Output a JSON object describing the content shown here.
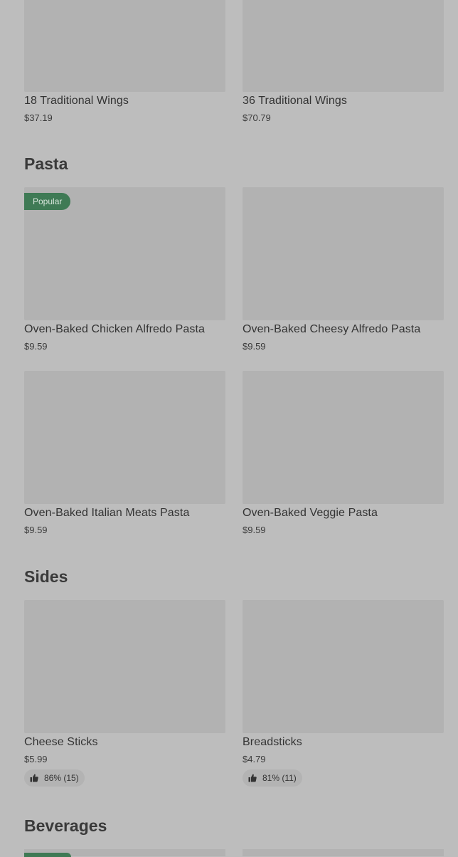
{
  "sections": {
    "wings": {
      "items": [
        {
          "name": "18 Traditional Wings",
          "price": "$37.19"
        },
        {
          "name": "36 Traditional Wings",
          "price": "$70.79"
        }
      ]
    },
    "pasta": {
      "title": "Pasta",
      "badge": "Popular",
      "items": [
        {
          "name": "Oven-Baked Chicken Alfredo Pasta",
          "price": "$9.59"
        },
        {
          "name": "Oven-Baked Cheesy Alfredo Pasta",
          "price": "$9.59"
        },
        {
          "name": "Oven-Baked Italian Meats Pasta",
          "price": "$9.59"
        },
        {
          "name": "Oven-Baked Veggie Pasta",
          "price": "$9.59"
        }
      ]
    },
    "sides": {
      "title": "Sides",
      "items": [
        {
          "name": "Cheese Sticks",
          "price": "$5.99",
          "rating": "86% (15)"
        },
        {
          "name": "Breadsticks",
          "price": "$4.79",
          "rating": "81% (11)"
        }
      ]
    },
    "beverages": {
      "title": "Beverages"
    }
  },
  "colors": {
    "background": "#bdbdbd",
    "image_placeholder": "#b2b2b2",
    "badge": "#3f7a55",
    "text": "#333333"
  },
  "icons": {
    "rating": "thumbs-up-icon"
  }
}
